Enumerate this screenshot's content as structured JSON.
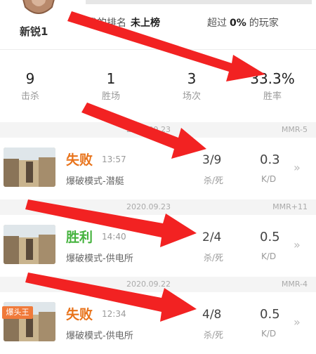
{
  "header": {
    "rank_name": "新锐1",
    "my_rank_label": "我的排名",
    "my_rank_value": "未上榜",
    "beyond_prefix": "超过",
    "beyond_value": "0%",
    "beyond_suffix": "的玩家"
  },
  "stats": [
    {
      "value": "9",
      "label": "击杀"
    },
    {
      "value": "1",
      "label": "胜场"
    },
    {
      "value": "3",
      "label": "场次"
    },
    {
      "value": "33.3%",
      "label": "胜率"
    }
  ],
  "matches": [
    {
      "date": "2020.09.23",
      "mmr": "MMR-5",
      "result": "失败",
      "result_color": "#e8731b",
      "time": "13:57",
      "mode": "爆破模式-潜艇",
      "kills_deaths": "3/9",
      "kd_label": "杀/死",
      "kd_ratio": "0.3",
      "ratio_label": "K/D",
      "badge": ""
    },
    {
      "date": "2020.09.23",
      "mmr": "MMR+11",
      "result": "胜利",
      "result_color": "#46b33f",
      "time": "14:40",
      "mode": "爆破模式-供电所",
      "kills_deaths": "2/4",
      "kd_label": "杀/死",
      "kd_ratio": "0.5",
      "ratio_label": "K/D",
      "badge": ""
    },
    {
      "date": "2020.09.22",
      "mmr": "MMR-4",
      "result": "失败",
      "result_color": "#e8731b",
      "time": "12:34",
      "mode": "爆破模式-供电所",
      "kills_deaths": "4/8",
      "kd_label": "杀/死",
      "kd_ratio": "0.5",
      "ratio_label": "K/D",
      "badge": "爆头王"
    }
  ],
  "icons": {
    "rank_badge": "rank-badge-icon",
    "chevron": "chevron-right-icon",
    "annotation_arrow": "red-arrow-icon"
  },
  "colors": {
    "arrow": "#f22222",
    "lose": "#e8731b",
    "win": "#46b33f",
    "badge": "#f07a3a"
  }
}
